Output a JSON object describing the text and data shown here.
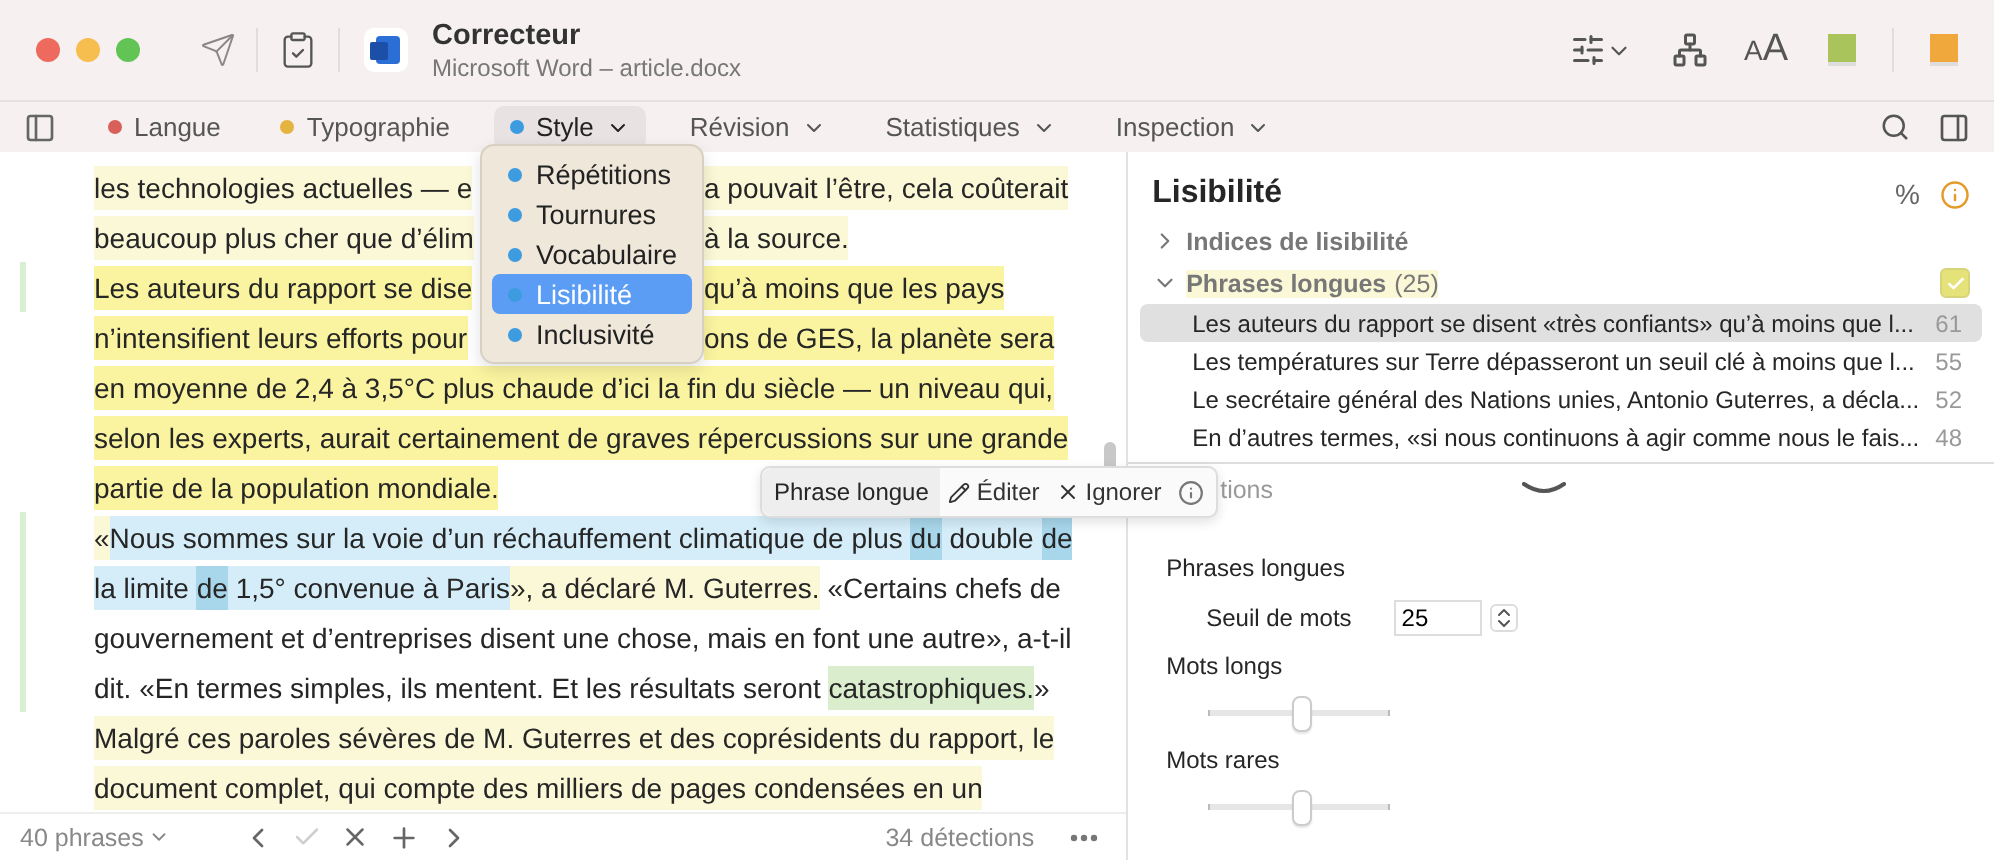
{
  "window": {
    "title": "Correcteur",
    "subtitle": "Microsoft Word – article.docx"
  },
  "toolbar": {
    "font_size_button": "AA"
  },
  "tabs": [
    {
      "label": "Langue",
      "color": "#d9605a",
      "selected": false,
      "dropdown": false
    },
    {
      "label": "Typographie",
      "color": "#e5b440",
      "selected": false,
      "dropdown": false
    },
    {
      "label": "Style",
      "color": "#3d9be0",
      "selected": true,
      "dropdown": true
    },
    {
      "label": "Révision",
      "selected": false,
      "dropdown": true
    },
    {
      "label": "Statistiques",
      "selected": false,
      "dropdown": true
    },
    {
      "label": "Inspection",
      "selected": false,
      "dropdown": true
    }
  ],
  "style_menu": {
    "items": [
      {
        "label": "Répétitions",
        "selected": false
      },
      {
        "label": "Tournures",
        "selected": false
      },
      {
        "label": "Vocabulaire",
        "selected": false
      },
      {
        "label": "Lisibilité",
        "selected": true
      },
      {
        "label": "Inclusivité",
        "selected": false
      }
    ]
  },
  "document": {
    "lines": [
      {
        "marker": false,
        "segments": [
          {
            "kind": "text",
            "text": "les technologies actuelles — e",
            "color": "#fbf8d7"
          },
          {
            "kind": "covered"
          },
          {
            "kind": "text",
            "text": "a pouvait l’être, cela coûterait",
            "color": "#fbf8d7"
          }
        ]
      },
      {
        "marker": false,
        "segments": [
          {
            "kind": "text",
            "text": "beaucoup plus cher que d’élim",
            "color": "#fbf8d7"
          },
          {
            "kind": "covered"
          },
          {
            "kind": "text",
            "text": "à la source.",
            "color": "#fbf8d7"
          }
        ]
      },
      {
        "marker": true,
        "segments": [
          {
            "kind": "text",
            "text": "Les auteurs du rapport se dise",
            "color": "#faf4a0"
          },
          {
            "kind": "covered"
          },
          {
            "kind": "text",
            "text": "qu’à moins que les pays",
            "color": "#faf4a0"
          }
        ]
      },
      {
        "marker": false,
        "segments": [
          {
            "kind": "text",
            "text": "n’intensifient leurs efforts pour",
            "color": "#faf4a0"
          },
          {
            "kind": "covered"
          },
          {
            "kind": "text",
            "text": "ons de GES, la planète sera",
            "color": "#faf4a0"
          }
        ]
      },
      {
        "marker": false,
        "segments": [
          {
            "kind": "text",
            "text": "en moyenne de 2,4 à 3,5°C plus chaude d’ici la fin du siècle — un niveau qui,",
            "color": "#faf4a0"
          }
        ]
      },
      {
        "marker": false,
        "segments": [
          {
            "kind": "text",
            "text": "selon les experts, aurait certainement de graves répercussions sur une grande",
            "color": "#faf4a0"
          }
        ]
      },
      {
        "marker": false,
        "segments": [
          {
            "kind": "text",
            "text": "partie de la population mondiale.",
            "color": "#faf4a0"
          }
        ]
      },
      {
        "marker": true,
        "segments": [
          {
            "kind": "text",
            "text": "«",
            "color": "#fbf8d7"
          },
          {
            "kind": "text",
            "text": "Nous sommes sur la voie d’un réchauffement climatique de plus ",
            "color": "#d4edf8"
          },
          {
            "kind": "text",
            "text": "du",
            "color": "#a8d6ea"
          },
          {
            "kind": "text",
            "text": " double ",
            "color": "#d4edf8"
          },
          {
            "kind": "text",
            "text": "de",
            "color": "#a8d6ea"
          }
        ]
      },
      {
        "marker": true,
        "segments": [
          {
            "kind": "text",
            "text": "la limite ",
            "color": "#d4edf8"
          },
          {
            "kind": "text",
            "text": "de",
            "color": "#a8d6ea"
          },
          {
            "kind": "text",
            "text": " 1,5° convenue à Paris",
            "color": "#d4edf8"
          },
          {
            "kind": "text",
            "text": "», a déclaré M. Guterres.",
            "color": "#fbf8d7"
          },
          {
            "kind": "text",
            "text": " «Certains chefs de"
          }
        ]
      },
      {
        "marker": true,
        "segments": [
          {
            "kind": "text",
            "text": "gouvernement et d’entreprises disent une chose, mais en font une autre», a-t-il"
          }
        ]
      },
      {
        "marker": true,
        "segments": [
          {
            "kind": "text",
            "text": "dit. «En termes simples, ils mentent. Et les résultats seront "
          },
          {
            "kind": "text",
            "text": "catastrophiques.",
            "color": "#daeecd"
          },
          {
            "kind": "text",
            "text": "»"
          }
        ]
      },
      {
        "marker": false,
        "segments": [
          {
            "kind": "text",
            "text": "Malgré ces paroles sévères de M. Guterres et des coprésidents du rapport, le",
            "color": "#fbf8d7"
          }
        ]
      },
      {
        "marker": false,
        "segments": [
          {
            "kind": "text",
            "text": "document complet, qui compte des milliers de pages condensées en un",
            "color": "#fbf8d7"
          }
        ]
      }
    ]
  },
  "popover": {
    "label": "Phrase longue",
    "actions": [
      {
        "kind": "edit",
        "label": "Éditer"
      },
      {
        "kind": "ignore",
        "label": "Ignorer"
      }
    ]
  },
  "status_bar": {
    "sentences": "40 phrases",
    "nav_buttons": [
      {
        "kind": "previous",
        "disabled": false
      },
      {
        "kind": "accept",
        "disabled": true
      },
      {
        "kind": "reject",
        "disabled": false
      },
      {
        "kind": "add",
        "disabled": false
      },
      {
        "kind": "next",
        "disabled": false
      }
    ],
    "detections": "34 détections"
  },
  "sidebar": {
    "title": "Lisibilité",
    "unit": "%",
    "sections": [
      {
        "label": "Indices de lisibilité",
        "expanded": false
      },
      {
        "label": "Phrases longues",
        "count": "(25)",
        "expanded": true,
        "checked": true,
        "items": [
          {
            "text": "Les auteurs du rapport se disent «très confiants» qu’à moins que l...",
            "words": "61",
            "selected": true
          },
          {
            "text": "Les températures sur Terre dépasseront un seuil clé à moins que l...",
            "words": "55",
            "selected": false
          },
          {
            "text": "Le secrétaire général des Nations unies, Antonio Guterres, a décla...",
            "words": "52",
            "selected": false
          },
          {
            "text": "En d’autres termes, «si nous continuons à agir comme nous le fais...",
            "words": "48",
            "selected": false
          }
        ]
      }
    ],
    "options_header": "tions",
    "settings": {
      "group_label": "Phrases longues",
      "threshold_label": "Seuil de mots",
      "threshold_value": "25",
      "sliders": [
        {
          "label": "Mots longs",
          "level": 0.5
        },
        {
          "label": "Mots rares",
          "level": 0.5
        }
      ]
    }
  }
}
